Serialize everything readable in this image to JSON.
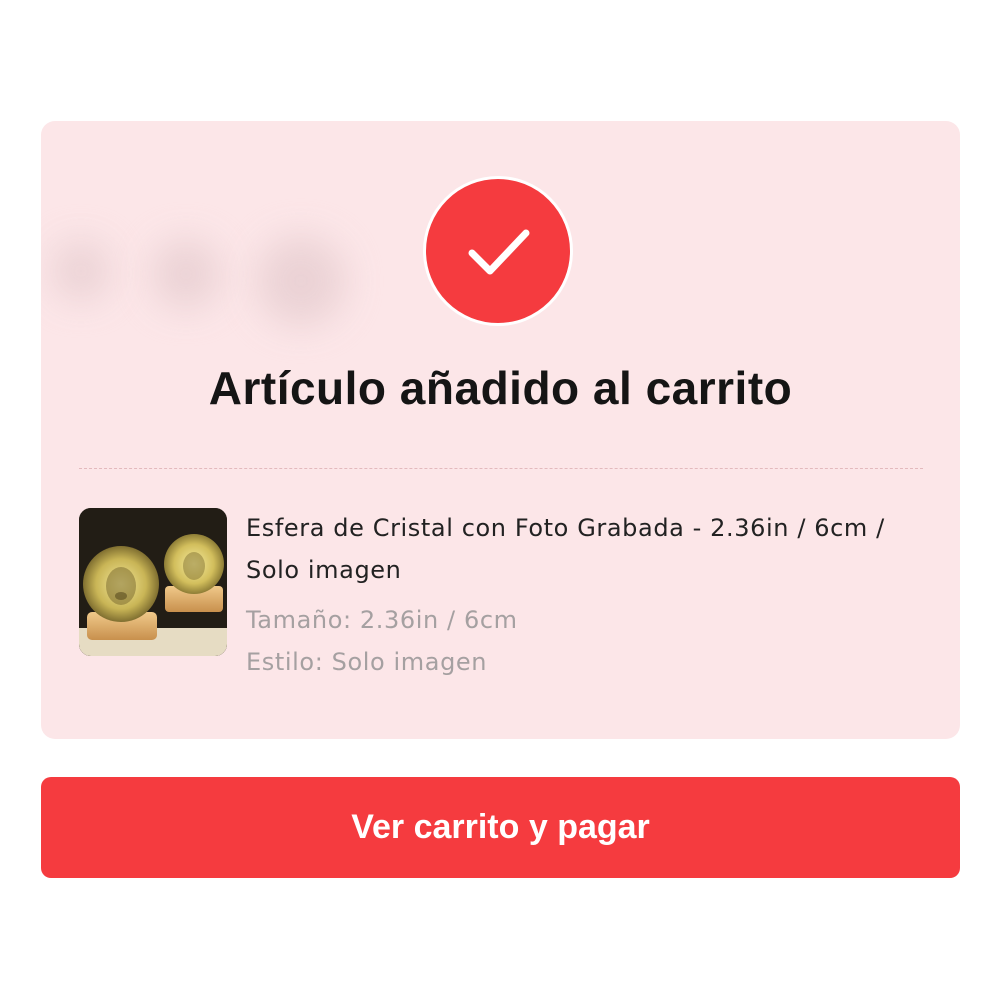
{
  "confirmation": {
    "title": "Artículo añadido al carrito",
    "icon": "check-icon",
    "accent_color": "#f53b3f",
    "background_color": "#fce6e8"
  },
  "product": {
    "name": "Esfera de Cristal con Foto Grabada - 2.36in / 6cm / Solo imagen",
    "image_icon": "product-thumbnail-crystal-sphere",
    "options": [
      {
        "label": "Tamaño",
        "value": "2.36in / 6cm",
        "text": "Tamaño: 2.36in / 6cm"
      },
      {
        "label": "Estilo",
        "value": "Solo imagen",
        "text": "Estilo: Solo imagen"
      }
    ]
  },
  "actions": {
    "checkout_label": "Ver carrito y pagar"
  }
}
